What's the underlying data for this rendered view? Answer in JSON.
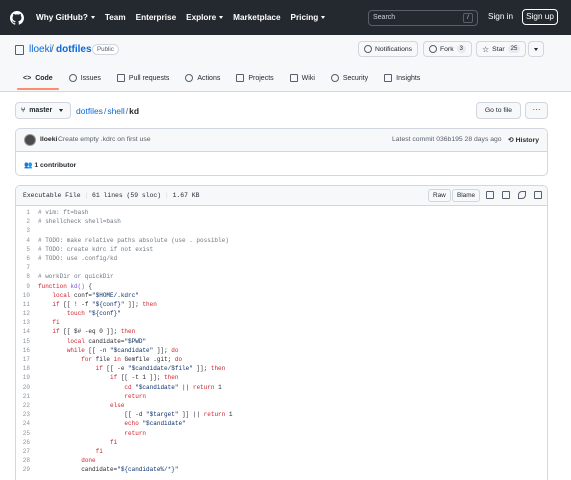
{
  "nav": {
    "items": [
      "Why GitHub?",
      "Team",
      "Enterprise",
      "Explore",
      "Marketplace",
      "Pricing"
    ],
    "search_placeholder": "Search",
    "slash_hint": "/",
    "signin": "Sign in",
    "signup": "Sign up"
  },
  "repo": {
    "owner": "lloeki",
    "name": "dotfiles",
    "visibility": "Public",
    "notifications": "Notifications",
    "fork": "Fork",
    "fork_count": "3",
    "star": "Star",
    "star_count": "25"
  },
  "tabs": [
    "Code",
    "Issues",
    "Pull requests",
    "Actions",
    "Projects",
    "Wiki",
    "Security",
    "Insights"
  ],
  "breadcrumb": {
    "branch": "master",
    "parts": [
      "dotfiles",
      "shell",
      "kd"
    ],
    "goto": "Go to file",
    "more": "···"
  },
  "commit": {
    "author": "lloeki",
    "message": "Create empty .kdrc on first use",
    "latest": "Latest commit 036b195 28 days ago",
    "history": "History",
    "contributors": "1 contributor"
  },
  "file": {
    "mode": "Executable File",
    "lines": "61 lines (59 sloc)",
    "size": "1.67 KB",
    "raw": "Raw",
    "blame": "Blame"
  },
  "code_lines": [
    "# vim: ft=bash",
    "# shellcheck shell=bash",
    "",
    "# TODO: make relative paths absolute (use . possible)",
    "# TODO: create kdrc if not exist",
    "# TODO: use .config/kd",
    "",
    "# workDir or quickDir",
    "function kd() {",
    "    local conf=\"$HOME/.kdrc\"",
    "    if [[ ! -f \"${conf}\" ]]; then",
    "        touch \"${conf}\"",
    "    fi",
    "    if [[ $# -eq 0 ]]; then",
    "        local candidate=\"$PWD\"",
    "        while [[ -n \"$candidate\" ]]; do",
    "            for file in Gemfile .git; do",
    "                if [[ -e \"$candidate/$file\" ]]; then",
    "                    if [[ -t 1 ]]; then",
    "                        cd \"$candidate\" || return 1",
    "                        return",
    "                    else",
    "                        [[ -d \"$target\" ]] || return 1",
    "                        echo \"$candidate\"",
    "                        return",
    "                    fi",
    "                fi",
    "            done",
    "            candidate=\"${candidate%/*}\""
  ]
}
